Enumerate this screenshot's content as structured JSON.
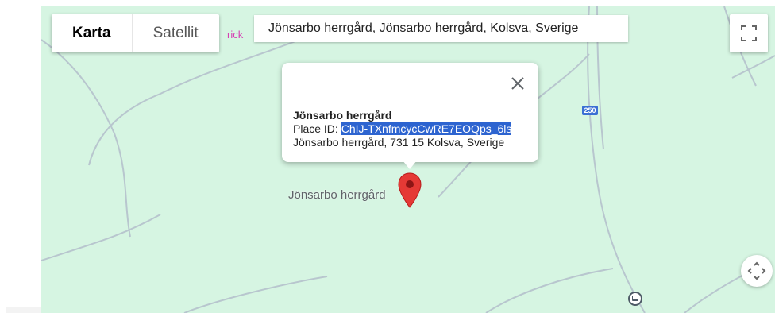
{
  "map_type": {
    "map_label": "Karta",
    "satellite_label": "Satellit",
    "selected": "Karta"
  },
  "partial_label": "rick",
  "search": {
    "value": "Jönsarbo herrgård, Jönsarbo herrgård, Kolsva, Sverige"
  },
  "info_window": {
    "title": "Jönsarbo herrgård",
    "place_id_label": "Place ID:",
    "place_id": "ChIJ-TXnfmcycCwRE7EOQps_6ls",
    "address": "Jönsarbo herrgård, 731 15 Kolsva, Sverige"
  },
  "marker_label": "Jönsarbo herrgård",
  "road_shield": "250",
  "icons": {
    "fullscreen": "fullscreen-icon",
    "close": "close-icon",
    "marker": "map-marker-icon",
    "pan": "pan-arrows-icon",
    "transit": "bus-stop-icon"
  },
  "colors": {
    "map_bg": "#d6f5e2",
    "road": "#b8c6ce",
    "marker": "#e53935",
    "selection": "#2d64d0",
    "shield": "#3b6fd4"
  }
}
